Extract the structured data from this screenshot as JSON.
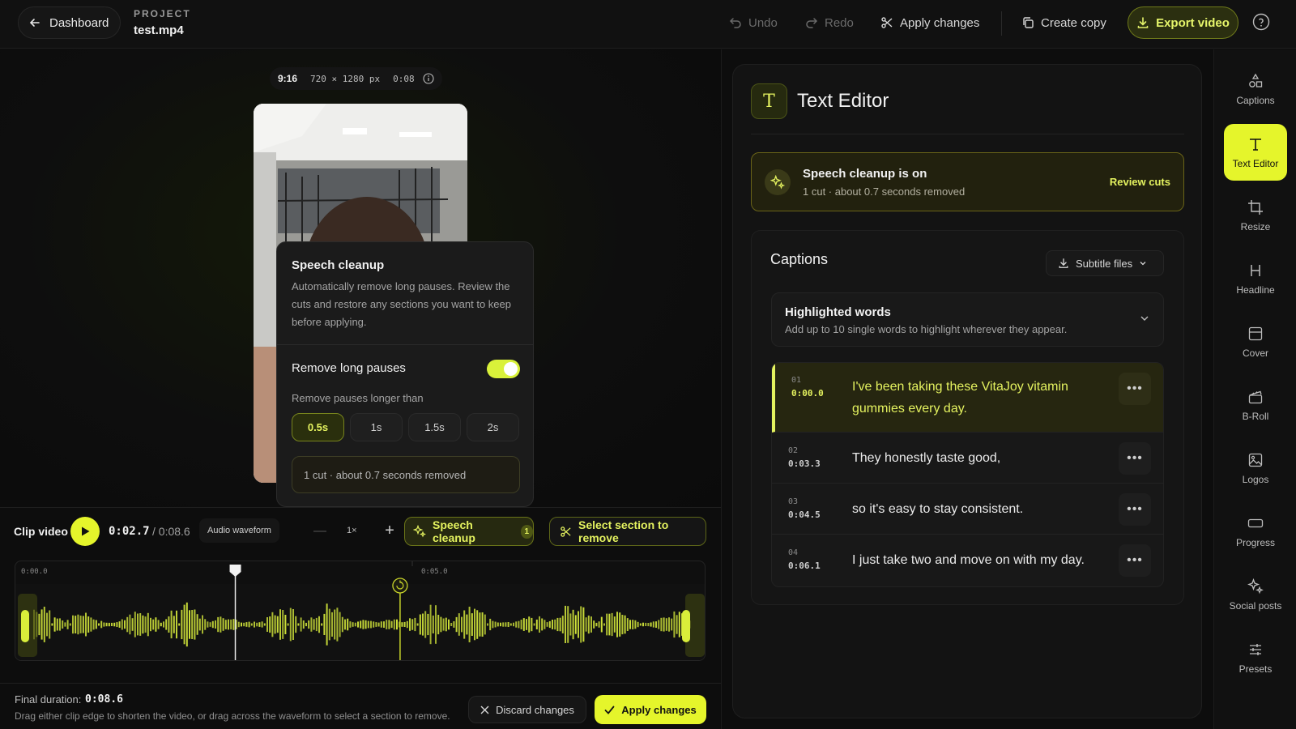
{
  "topbar": {
    "back_label": "Dashboard",
    "project_label": "PROJECT",
    "project_name": "test.mp4",
    "undo": "Undo",
    "redo": "Redo",
    "apply": "Apply changes",
    "copy": "Create copy",
    "export": "Export video"
  },
  "video_meta": {
    "ratio": "9:16",
    "resolution": "720 × 1280 px",
    "duration": "0:08"
  },
  "cleanup_popover": {
    "title": "Speech cleanup",
    "description": "Automatically remove long pauses. Review the cuts and restore any sections you want to keep before applying.",
    "toggle_label": "Remove long pauses",
    "toggle_on": true,
    "threshold_label": "Remove pauses longer than",
    "options": [
      "0.5s",
      "1s",
      "1.5s",
      "2s"
    ],
    "selected": "0.5s",
    "result": "1 cut · about 0.7 seconds removed"
  },
  "clip_controls": {
    "label": "Clip video",
    "current_time": "0:02.7",
    "total_time": "/ 0:08.6",
    "waveform_label": "Audio waveform",
    "zoom": "1×",
    "speech_cleanup": "Speech cleanup",
    "speech_cleanup_count": "1",
    "select_section": "Select section to remove"
  },
  "timeline": {
    "tick_start": "0:00.0",
    "tick_mid": "0:05.0",
    "playhead_time": 2.7,
    "cut_time": 4.8,
    "total_seconds": 8.6
  },
  "footer": {
    "final_label": "Final duration:",
    "final_value": "0:08.6",
    "hint": "Drag either clip edge to shorten the video, or drag across the waveform to select a section to remove.",
    "discard": "Discard changes",
    "apply": "Apply changes"
  },
  "editor": {
    "title": "Text Editor",
    "banner_title": "Speech cleanup is on",
    "banner_sub": "1 cut · about 0.7 seconds removed",
    "banner_link": "Review cuts",
    "captions_title": "Captions",
    "subtitle_files": "Subtitle files",
    "highlight_title": "Highlighted words",
    "highlight_sub": "Add up to 10 single words to highlight wherever they appear.",
    "captions": [
      {
        "idx": "01",
        "time": "0:00.0",
        "text": "I've been taking these VitaJoy vitamin gummies every day."
      },
      {
        "idx": "02",
        "time": "0:03.3",
        "text": "They honestly taste good,"
      },
      {
        "idx": "03",
        "time": "0:04.5",
        "text": "so it's easy to stay consistent."
      },
      {
        "idx": "04",
        "time": "0:06.1",
        "text": "I just take two and move on with my day."
      }
    ]
  },
  "rail": [
    {
      "label": "Captions",
      "icon": "shapes-icon"
    },
    {
      "label": "Text Editor",
      "icon": "text-icon",
      "active": true
    },
    {
      "label": "Resize",
      "icon": "crop-icon"
    },
    {
      "label": "Headline",
      "icon": "heading-icon"
    },
    {
      "label": "Cover",
      "icon": "cover-icon"
    },
    {
      "label": "B-Roll",
      "icon": "clapper-icon"
    },
    {
      "label": "Logos",
      "icon": "image-icon"
    },
    {
      "label": "Progress",
      "icon": "progress-icon"
    },
    {
      "label": "Social posts",
      "icon": "sparkle-icon"
    },
    {
      "label": "Presets",
      "icon": "sliders-icon"
    }
  ],
  "colors": {
    "accent": "#e5f52b",
    "background": "#0d0d0d"
  }
}
